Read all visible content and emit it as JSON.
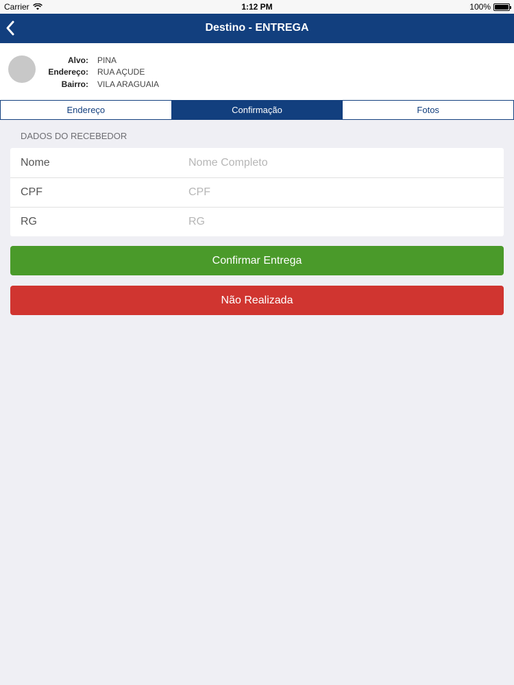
{
  "status_bar": {
    "carrier": "Carrier",
    "time": "1:12 PM",
    "battery": "100%",
    "battery_level": 1.0
  },
  "nav": {
    "title": "Destino - ENTREGA",
    "back_icon": "chevron-left-icon"
  },
  "info": {
    "alvo_label": "Alvo:",
    "alvo_value": "PINA",
    "endereco_label": "Endereço:",
    "endereco_value": "RUA AÇUDE",
    "bairro_label": "Bairro:",
    "bairro_value": "VILA ARAGUAIA"
  },
  "tabs": [
    {
      "label": "Endereço",
      "active": false
    },
    {
      "label": "Confirmação",
      "active": true
    },
    {
      "label": "Fotos",
      "active": false
    }
  ],
  "section": {
    "title": "DADOS DO RECEBEDOR"
  },
  "form": {
    "fields": [
      {
        "label": "Nome",
        "placeholder": "Nome Completo",
        "value": ""
      },
      {
        "label": "CPF",
        "placeholder": "CPF",
        "value": ""
      },
      {
        "label": "RG",
        "placeholder": "RG",
        "value": ""
      }
    ]
  },
  "buttons": {
    "confirm_label": "Confirmar Entrega",
    "fail_label": "Não Realizada"
  },
  "colors": {
    "primary": "#123f7e",
    "confirm": "#4a9a2a",
    "fail": "#d03530",
    "background": "#efeff4"
  }
}
